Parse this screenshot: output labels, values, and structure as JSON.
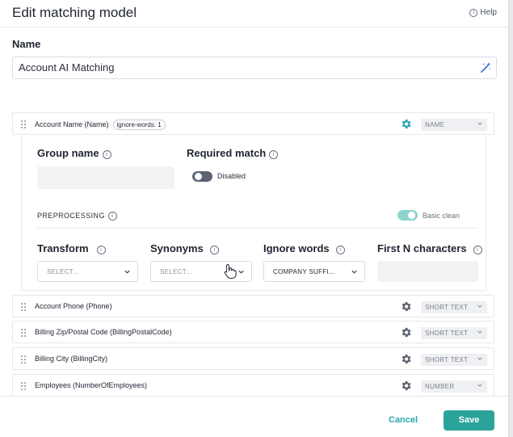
{
  "header": {
    "title": "Edit matching model",
    "help_label": "Help"
  },
  "name": {
    "label": "Name",
    "value": "Account AI Matching"
  },
  "fields": [
    {
      "label": "Account Name (Name)",
      "tag": "ignore-words: 1",
      "type": "NAME",
      "active": true
    },
    {
      "label": "Account Phone (Phone)",
      "type": "SHORT TEXT"
    },
    {
      "label": "Billing Zip/Postal Code (BillingPostalCode)",
      "type": "SHORT TEXT"
    },
    {
      "label": "Billing City (BillingCity)",
      "type": "SHORT TEXT"
    },
    {
      "label": "Employees (NumberOfEmployees)",
      "type": "NUMBER"
    }
  ],
  "expanded": {
    "group_name_label": "Group name",
    "group_name_value": "",
    "required_match_label": "Required match",
    "required_match_state": "Disabled",
    "preprocessing_label": "PREPROCESSING",
    "basic_clean_label": "Basic clean",
    "transform": {
      "label": "Transform",
      "value": "SELECT..."
    },
    "synonyms": {
      "label": "Synonyms",
      "value": "SELECT..."
    },
    "ignore_words": {
      "label": "Ignore words",
      "value": "COMPANY SUFFI..."
    },
    "first_n": {
      "label": "First N characters",
      "value": ""
    }
  },
  "footer": {
    "cancel_label": "Cancel",
    "save_label": "Save"
  },
  "colors": {
    "accent": "#2ba39a",
    "gear_active": "#2aa7b0",
    "gear_inactive": "#5b616e"
  }
}
